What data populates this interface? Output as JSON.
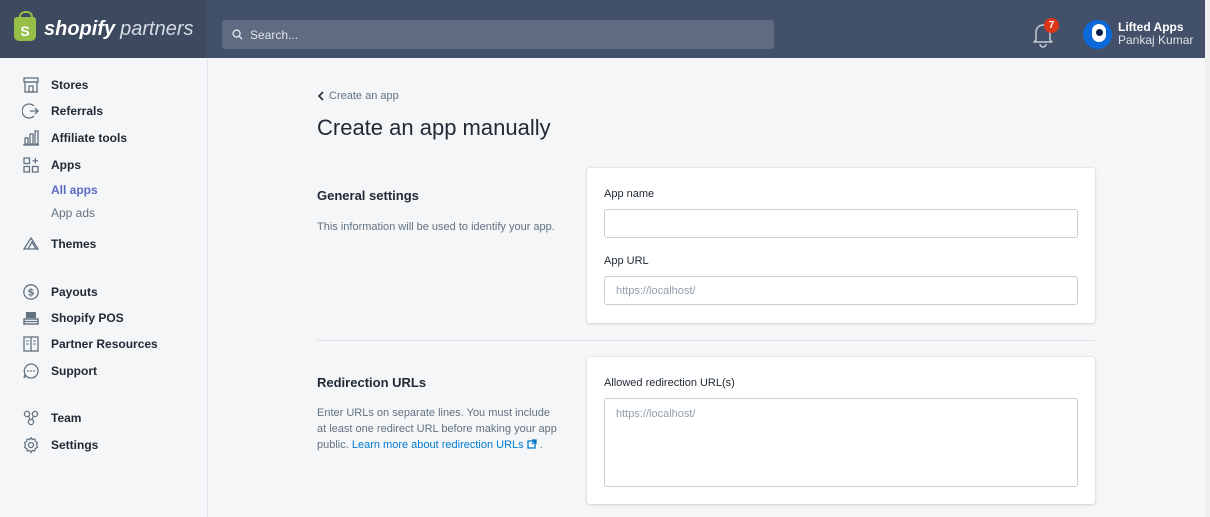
{
  "brand": {
    "logo_letter": "S",
    "word1": "shopify",
    "word2": "partners"
  },
  "search": {
    "placeholder": "Search..."
  },
  "notifications": {
    "count": "7"
  },
  "account": {
    "name": "Lifted Apps",
    "user": "Pankaj Kumar"
  },
  "sidebar": {
    "items": [
      {
        "label": "Stores",
        "icon": "store-icon"
      },
      {
        "label": "Referrals",
        "icon": "referral-icon"
      },
      {
        "label": "Affiliate tools",
        "icon": "chart-icon"
      },
      {
        "label": "Apps",
        "icon": "apps-icon"
      },
      {
        "label": "Themes",
        "icon": "themes-icon"
      },
      {
        "label": "Payouts",
        "icon": "dollar-icon"
      },
      {
        "label": "Shopify POS",
        "icon": "pos-icon"
      },
      {
        "label": "Partner Resources",
        "icon": "book-icon"
      },
      {
        "label": "Support",
        "icon": "chat-icon"
      },
      {
        "label": "Team",
        "icon": "team-icon"
      },
      {
        "label": "Settings",
        "icon": "gear-icon"
      }
    ],
    "apps_sub": [
      "All apps",
      "App ads"
    ]
  },
  "page": {
    "back_label": "Create an app",
    "title": "Create an app manually"
  },
  "general": {
    "title": "General settings",
    "desc": "This information will be used to identify your app.",
    "app_name_label": "App name",
    "app_name_value": "",
    "app_url_label": "App URL",
    "app_url_placeholder": "https://localhost/"
  },
  "redirect": {
    "title": "Redirection URLs",
    "desc": "Enter URLs on separate lines. You must include at least one redirect URL before making your app public.",
    "link": "Learn more about redirection URLs",
    "trail": ".",
    "field_label": "Allowed redirection URL(s)",
    "field_placeholder": "https://localhost/"
  },
  "colors": {
    "accent": "#5c6ac4",
    "link": "#007ace",
    "topbar": "#43506a",
    "badge": "#de3618",
    "brand_green": "#95bf47"
  }
}
